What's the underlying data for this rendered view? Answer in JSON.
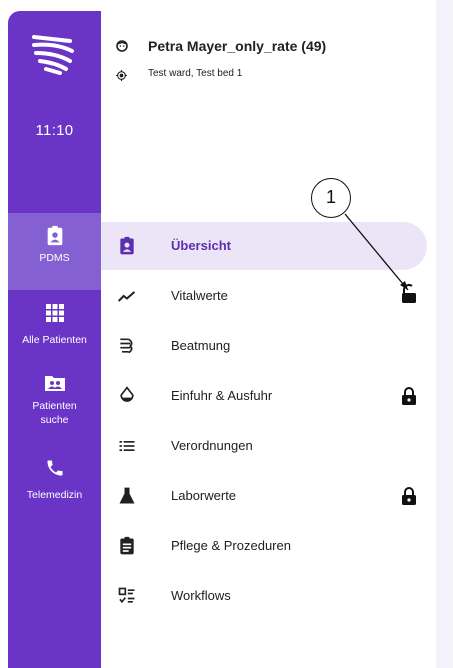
{
  "rail": {
    "time": "11:10",
    "items": [
      {
        "label": "PDMS",
        "icon": "clipboard-user-icon",
        "active": true
      },
      {
        "label": "Alle Patienten",
        "icon": "grid-icon",
        "active": false
      },
      {
        "label": "Patienten suche",
        "icon": "folder-user-icon",
        "active": false
      },
      {
        "label": "Telemedizin",
        "icon": "phone-icon",
        "active": false
      }
    ]
  },
  "patient": {
    "name": "Petra Mayer_only_rate (49)",
    "location": "Test ward, Test bed 1"
  },
  "menu": [
    {
      "label": "Übersicht",
      "icon": "clipboard-user-icon",
      "active": true,
      "locked": false
    },
    {
      "label": "Vitalwerte",
      "icon": "trend-line-icon",
      "active": false,
      "locked": true,
      "lock_state": "unlocked"
    },
    {
      "label": "Beatmung",
      "icon": "lungs-icon",
      "active": false,
      "locked": false
    },
    {
      "label": "Einfuhr & Ausfuhr",
      "icon": "drop-icon",
      "active": false,
      "locked": true
    },
    {
      "label": "Verordnungen",
      "icon": "list-icon",
      "active": false,
      "locked": false
    },
    {
      "label": "Laborwerte",
      "icon": "flask-icon",
      "active": false,
      "locked": true
    },
    {
      "label": "Pflege & Prozeduren",
      "icon": "clipboard-text-icon",
      "active": false,
      "locked": false
    },
    {
      "label": "Workflows",
      "icon": "checklist-icon",
      "active": false,
      "locked": false
    }
  ],
  "callout": {
    "number": "1"
  },
  "colors": {
    "rail": "#6a35c7",
    "rail_active": "#8460d3",
    "menu_active_bg": "#ece5f8",
    "accent_text": "#5b2fb0"
  }
}
